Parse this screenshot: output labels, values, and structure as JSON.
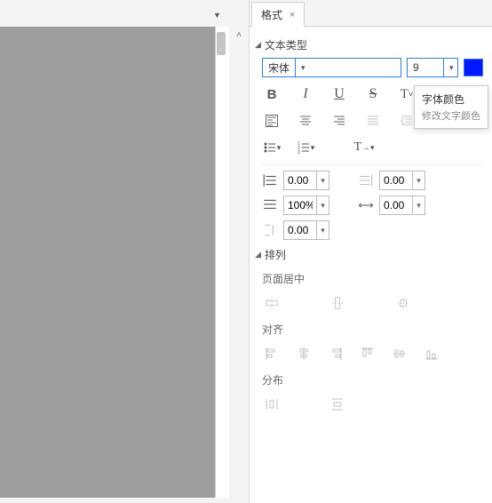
{
  "tab": {
    "label": "格式",
    "close_glyph": "×"
  },
  "section_text": {
    "title": "文本类型",
    "font_name": "宋体",
    "font_size": "9",
    "color_hex": "#0018ff",
    "bold_glyph": "B",
    "italic_glyph": "I",
    "tooltip_title": "字体颜色",
    "tooltip_desc": "修改文字颜色",
    "indent_left_value": "0.00",
    "indent_right_value": "0.00",
    "line_spacing_value": "100%",
    "char_spacing_value": "0.00",
    "para_spacing_value": "0.00"
  },
  "section_arrange": {
    "title": "排列",
    "center_page_label": "页面居中",
    "align_label": "对齐",
    "distribute_label": "分布"
  },
  "icons": {
    "dropdown": "▾",
    "collapse": "▸"
  }
}
